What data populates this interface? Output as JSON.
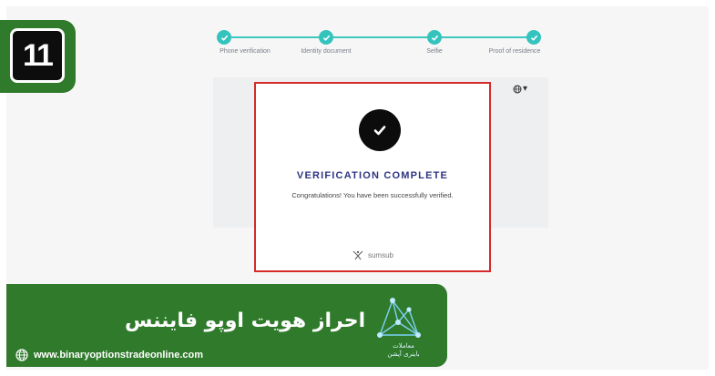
{
  "step_badge": {
    "number": "11"
  },
  "stepper": {
    "steps": [
      {
        "label": "Phone verification",
        "status": "done"
      },
      {
        "label": "Identity document",
        "status": "done"
      },
      {
        "label": "Selfie",
        "status": "done"
      },
      {
        "label": "Proof of residence",
        "status": "done"
      }
    ],
    "accent_color": "#35c3bd"
  },
  "language_selector": {
    "icon": "globe-icon",
    "caret": "▾"
  },
  "card": {
    "title": "VERIFICATION COMPLETE",
    "message": "Congratulations! You have been successfully verified.",
    "brand": "sumsub",
    "highlight_color": "#d42a2a"
  },
  "banner": {
    "title": "احراز هویت اوپو فایننس",
    "logo_text_line1": "معاملات",
    "logo_text_line2": "باینری آپشن",
    "url": "www.binaryoptionstradeonline.com",
    "color": "#2f7a2b"
  }
}
